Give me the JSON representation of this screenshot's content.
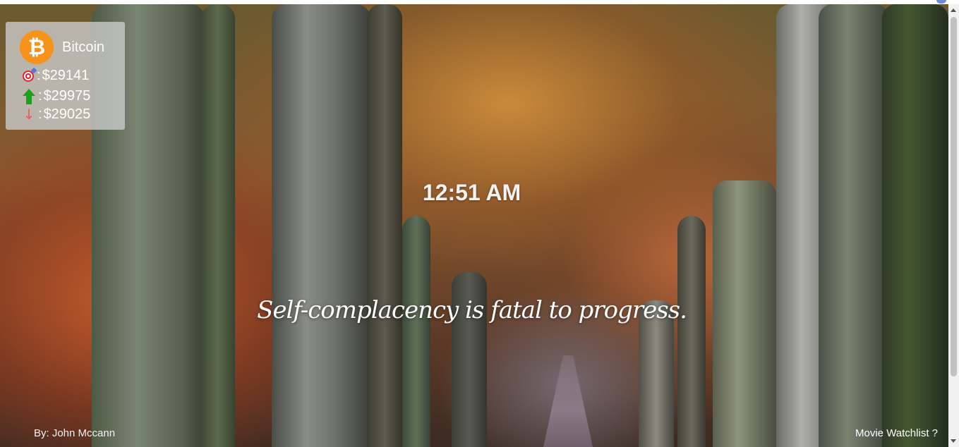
{
  "crypto": {
    "name": "Bitcoin",
    "symbol_glyph": "₿",
    "current_price": "$29141",
    "high_price": "$29975",
    "low_price": "$29025",
    "current_icon": "target-icon",
    "high_icon": "arrow-up-icon",
    "low_icon": "arrow-down-icon",
    "separator": ":",
    "accent_color": "#f7931a"
  },
  "clock": {
    "time": "12:51 AM"
  },
  "quote": {
    "text": "Self-complacency is fatal to progress."
  },
  "footer": {
    "author": "By: John Mccann",
    "watchlist_link": "Movie Watchlist ?"
  }
}
